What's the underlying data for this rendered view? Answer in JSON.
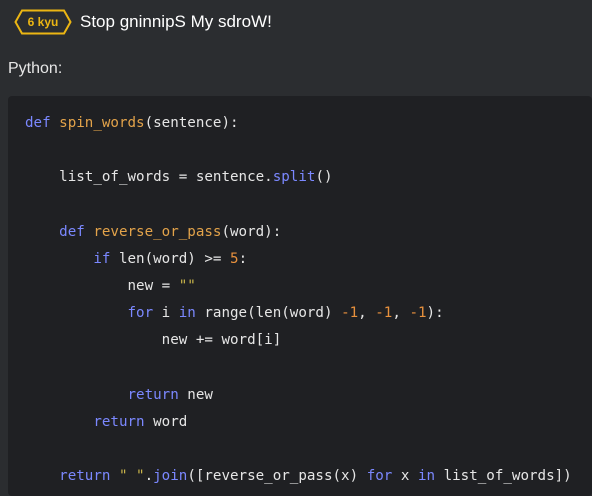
{
  "header": {
    "kyu_label": "6 kyu",
    "title": "Stop gninnipS My sdroW!",
    "accent_color": "#ecb613"
  },
  "language_label": "Python:",
  "code": {
    "lines": [
      {
        "indent": "",
        "tokens": [
          {
            "t": "def",
            "k": "kw"
          },
          {
            "t": " ",
            "k": "pl"
          },
          {
            "t": "spin_words",
            "k": "fn"
          },
          {
            "t": "(sentence):",
            "k": "pl"
          }
        ]
      },
      {
        "indent": "",
        "tokens": []
      },
      {
        "indent": "    ",
        "tokens": [
          {
            "t": "list_of_words = sentence.",
            "k": "pl"
          },
          {
            "t": "split",
            "k": "kw"
          },
          {
            "t": "()",
            "k": "pl"
          }
        ]
      },
      {
        "indent": "",
        "tokens": []
      },
      {
        "indent": "    ",
        "tokens": [
          {
            "t": "def",
            "k": "kw"
          },
          {
            "t": " ",
            "k": "pl"
          },
          {
            "t": "reverse_or_pass",
            "k": "fn"
          },
          {
            "t": "(word):",
            "k": "pl"
          }
        ]
      },
      {
        "indent": "        ",
        "tokens": [
          {
            "t": "if",
            "k": "kw"
          },
          {
            "t": " len(word) >= ",
            "k": "pl"
          },
          {
            "t": "5",
            "k": "nm"
          },
          {
            "t": ":",
            "k": "pl"
          }
        ]
      },
      {
        "indent": "            ",
        "tokens": [
          {
            "t": "new = ",
            "k": "pl"
          },
          {
            "t": "\"\"",
            "k": "st"
          }
        ]
      },
      {
        "indent": "            ",
        "tokens": [
          {
            "t": "for",
            "k": "kw"
          },
          {
            "t": " i ",
            "k": "pl"
          },
          {
            "t": "in",
            "k": "kw"
          },
          {
            "t": " range(len(word) ",
            "k": "pl"
          },
          {
            "t": "-1",
            "k": "nm"
          },
          {
            "t": ", ",
            "k": "pl"
          },
          {
            "t": "-1",
            "k": "nm"
          },
          {
            "t": ", ",
            "k": "pl"
          },
          {
            "t": "-1",
            "k": "nm"
          },
          {
            "t": "):",
            "k": "pl"
          }
        ]
      },
      {
        "indent": "                ",
        "tokens": [
          {
            "t": "new += word[i]",
            "k": "pl"
          }
        ]
      },
      {
        "indent": "",
        "tokens": []
      },
      {
        "indent": "            ",
        "tokens": [
          {
            "t": "return",
            "k": "kw"
          },
          {
            "t": " new",
            "k": "pl"
          }
        ]
      },
      {
        "indent": "        ",
        "tokens": [
          {
            "t": "return",
            "k": "kw"
          },
          {
            "t": " word",
            "k": "pl"
          }
        ]
      },
      {
        "indent": "",
        "tokens": []
      },
      {
        "indent": "    ",
        "tokens": [
          {
            "t": "return",
            "k": "kw"
          },
          {
            "t": " ",
            "k": "pl"
          },
          {
            "t": "\" \"",
            "k": "st"
          },
          {
            "t": ".",
            "k": "pl"
          },
          {
            "t": "join",
            "k": "kw"
          },
          {
            "t": "([reverse_or_pass(x) ",
            "k": "pl"
          },
          {
            "t": "for",
            "k": "kw"
          },
          {
            "t": " x ",
            "k": "pl"
          },
          {
            "t": "in",
            "k": "kw"
          },
          {
            "t": " list_of_words])",
            "k": "pl"
          }
        ]
      }
    ]
  }
}
